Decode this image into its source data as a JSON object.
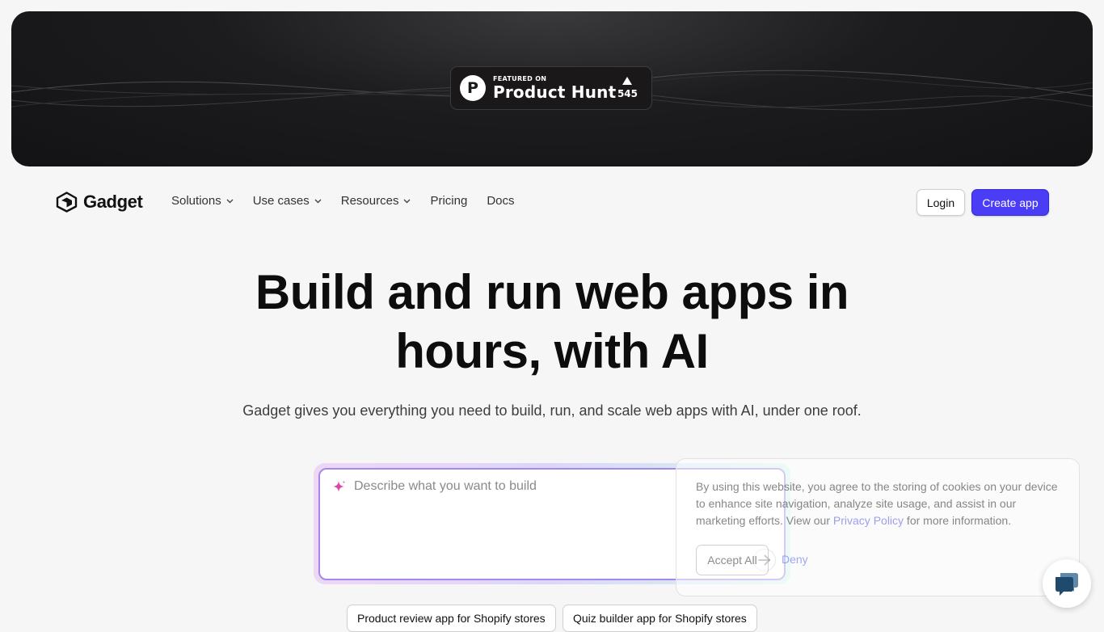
{
  "banner": {
    "badge_small": "FEATURED ON",
    "badge_big": "Product Hunt",
    "badge_logo_letter": "P",
    "votes": "545"
  },
  "nav": {
    "brand": "Gadget",
    "links": [
      {
        "label": "Solutions",
        "dropdown": true
      },
      {
        "label": "Use cases",
        "dropdown": true
      },
      {
        "label": "Resources",
        "dropdown": true
      },
      {
        "label": "Pricing",
        "dropdown": false
      },
      {
        "label": "Docs",
        "dropdown": false
      }
    ],
    "login_label": "Login",
    "create_label": "Create app"
  },
  "hero": {
    "headline_line1": "Build and run web apps in",
    "headline_line2": "hours, with AI",
    "subheadline": "Gadget gives you everything you need to build, run, and scale web apps with AI, under one roof."
  },
  "prompt": {
    "placeholder": "Describe what you want to build",
    "value": ""
  },
  "chips": [
    "Product review app for Shopify stores",
    "Quiz builder app for Shopify stores"
  ],
  "cookie": {
    "text_before": "By using this website, you agree to the storing of cookies on your device to enhance site navigation, analyze site usage, and assist in our marketing efforts. View our ",
    "link_label": "Privacy Policy",
    "text_after": " for more information.",
    "accept_label": "Accept All",
    "deny_label": "Deny"
  },
  "colors": {
    "accent": "#4a3df5",
    "banner_bg": "#1c1c1e",
    "page_bg": "#f6f6f6",
    "chat_icon": "#1e4a6e"
  },
  "icons": {
    "banner_badge": "product-hunt-icon",
    "brand_logo": "gadget-logo-icon",
    "dropdown": "chevron-down-icon",
    "prompt": "sparkle-icon",
    "submit": "arrow-right-icon",
    "chat": "chat-bubble-icon"
  }
}
